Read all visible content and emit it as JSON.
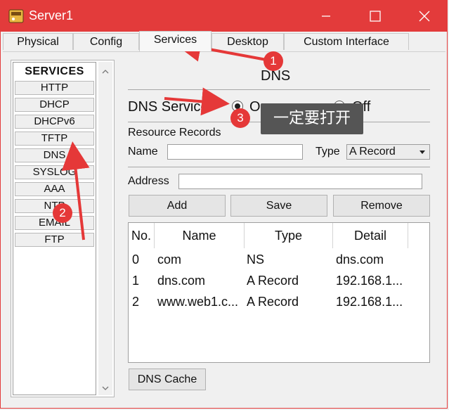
{
  "window": {
    "title": "Server1",
    "icon": "server-app-icon"
  },
  "tabs": [
    {
      "label": "Physical"
    },
    {
      "label": "Config"
    },
    {
      "label": "Services"
    },
    {
      "label": "Desktop"
    },
    {
      "label": "Custom Interface"
    }
  ],
  "services": {
    "header": "SERVICES",
    "items": [
      {
        "label": "HTTP"
      },
      {
        "label": "DHCP"
      },
      {
        "label": "DHCPv6"
      },
      {
        "label": "TFTP"
      },
      {
        "label": "DNS"
      },
      {
        "label": "SYSLOG"
      },
      {
        "label": "AAA"
      },
      {
        "label": "NTP"
      },
      {
        "label": "EMAIL"
      },
      {
        "label": "FTP"
      }
    ]
  },
  "dns": {
    "title": "DNS",
    "service_label": "DNS Service",
    "on_label": "On",
    "off_label": "Off",
    "service_on": true,
    "resource_records_label": "Resource Records",
    "name_label": "Name",
    "name_value": "",
    "type_label": "Type",
    "type_value": "A Record",
    "address_label": "Address",
    "address_value": "",
    "add_button": "Add",
    "save_button": "Save",
    "remove_button": "Remove",
    "cache_button": "DNS Cache",
    "table": {
      "headers": [
        "No.",
        "Name",
        "Type",
        "Detail"
      ],
      "rows": [
        [
          "0",
          "com",
          "NS",
          "dns.com"
        ],
        [
          "1",
          "dns.com",
          "A Record",
          "192.168.1..."
        ],
        [
          "2",
          "www.web1.c...",
          "A Record",
          "192.168.1..."
        ]
      ]
    }
  },
  "annotations": {
    "badge1": "1",
    "badge2": "2",
    "badge3": "3",
    "tooltip": "一定要打开",
    "color": "#e53838"
  }
}
